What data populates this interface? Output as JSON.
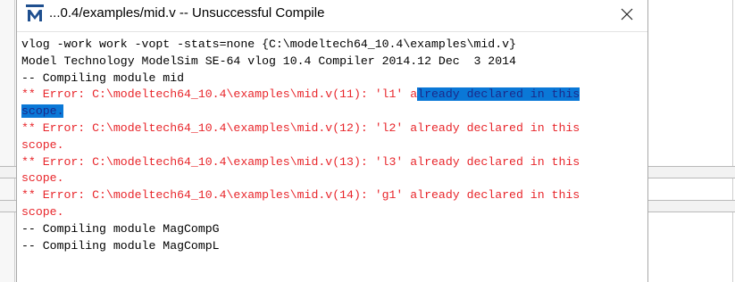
{
  "window": {
    "title": "...0.4/examples/mid.v  -- Unsuccessful Compile",
    "app_icon": "modelsim-m-icon",
    "close_icon": "close-icon"
  },
  "output": {
    "lines": [
      {
        "text": "vlog -work work -vopt -stats=none {C:\\modeltech64_10.4\\examples\\mid.v}",
        "kind": "normal"
      },
      {
        "text": "Model Technology ModelSim SE-64 vlog 10.4 Compiler 2014.12 Dec  3 2014",
        "kind": "normal"
      },
      {
        "text": "-- Compiling module mid",
        "kind": "normal"
      },
      {
        "text": "** Error: C:\\modeltech64_10.4\\examples\\mid.v(11): 'l1' a",
        "kind": "error",
        "selected_text": "lready declared in this"
      },
      {
        "text": "",
        "kind": "error",
        "selected_text": "scope."
      },
      {
        "text": "** Error: C:\\modeltech64_10.4\\examples\\mid.v(12): 'l2' already declared in this",
        "kind": "error"
      },
      {
        "text": "scope.",
        "kind": "error"
      },
      {
        "text": "** Error: C:\\modeltech64_10.4\\examples\\mid.v(13): 'l3' already declared in this",
        "kind": "error"
      },
      {
        "text": "scope.",
        "kind": "error"
      },
      {
        "text": "** Error: C:\\modeltech64_10.4\\examples\\mid.v(14): 'g1' already declared in this",
        "kind": "error"
      },
      {
        "text": "scope.",
        "kind": "error"
      },
      {
        "text": "-- Compiling module MagCompG",
        "kind": "normal"
      },
      {
        "text": "-- Compiling module MagCompL",
        "kind": "normal"
      }
    ]
  },
  "colors": {
    "error_text": "#e8262b",
    "normal_text": "#000000",
    "selection_bg": "#0a78d7"
  }
}
